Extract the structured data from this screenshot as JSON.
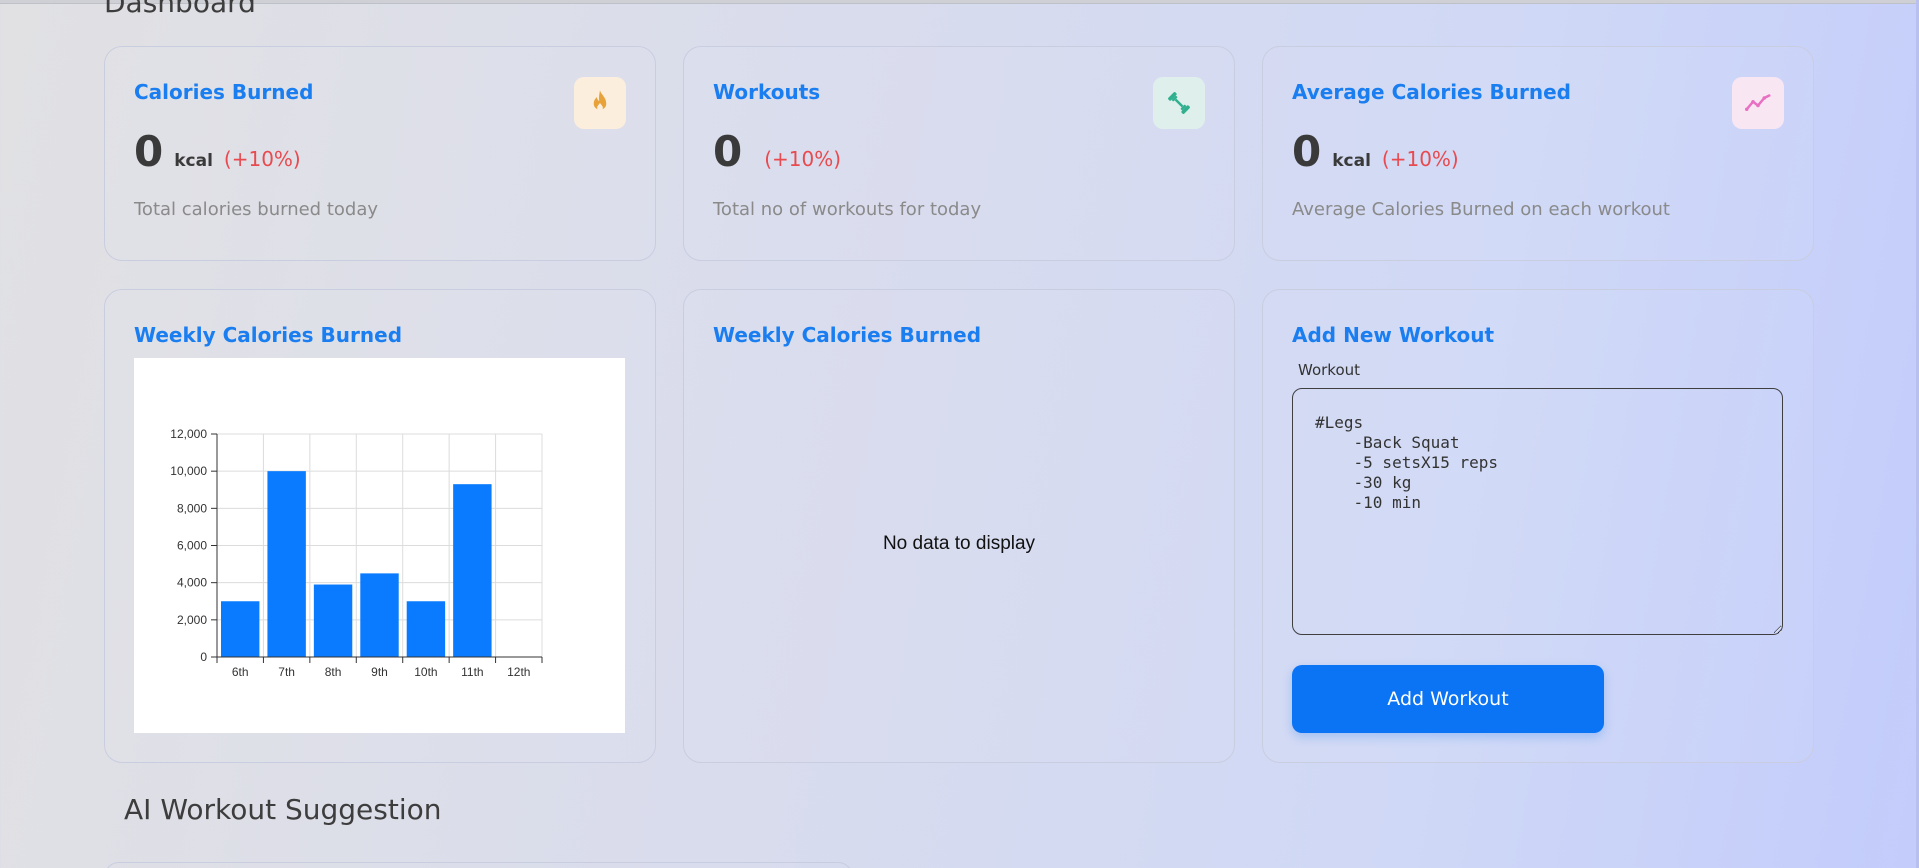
{
  "dashboard": {
    "title": "Dashboard"
  },
  "stats": [
    {
      "title": "Calories Burned",
      "value": "0",
      "unit": "kcal",
      "change": "(+10%)",
      "description": "Total calories burned today",
      "icon": "fire-icon",
      "icon_color": "#e8a23a",
      "icon_bg": "#fbeedd"
    },
    {
      "title": "Workouts",
      "value": "0",
      "unit": "",
      "change": "(+10%)",
      "description": "Total no of workouts for today",
      "icon": "dumbbell-icon",
      "icon_color": "#31b08f",
      "icon_bg": "#dff0ec"
    },
    {
      "title": "Average Calories Burned",
      "value": "0",
      "unit": "kcal",
      "change": "(+10%)",
      "description": "Average Calories Burned on each workout",
      "icon": "trend-up-icon",
      "icon_color": "#e86fc2",
      "icon_bg": "#f9e6f3"
    }
  ],
  "weekly_chart": {
    "title": "Weekly Calories Burned"
  },
  "weekly_pie": {
    "title": "Weekly Calories Burned",
    "empty_text": "No data to display"
  },
  "add_workout": {
    "title": "Add New Workout",
    "label": "Workout",
    "value": "#Legs\n    -Back Squat\n    -5 setsX15 reps\n    -30 kg\n    -10 min",
    "button_label": "Add Workout"
  },
  "suggestion": {
    "title": "AI Workout Suggestion"
  },
  "colors": {
    "accent": "#1a7ef0",
    "button": "#0a74f5",
    "bar": "#0a7bff",
    "negative": "#e84a4f"
  },
  "chart_data": {
    "type": "bar",
    "title": "Weekly Calories Burned",
    "categories": [
      "6th",
      "7th",
      "8th",
      "9th",
      "10th",
      "11th",
      "12th"
    ],
    "values": [
      3000,
      10000,
      3900,
      4500,
      3000,
      9300,
      0
    ],
    "yticks": [
      "0",
      "2,000",
      "4,000",
      "6,000",
      "8,000",
      "10,000",
      "12,000"
    ],
    "ylim": [
      0,
      12000
    ],
    "grid": true
  }
}
